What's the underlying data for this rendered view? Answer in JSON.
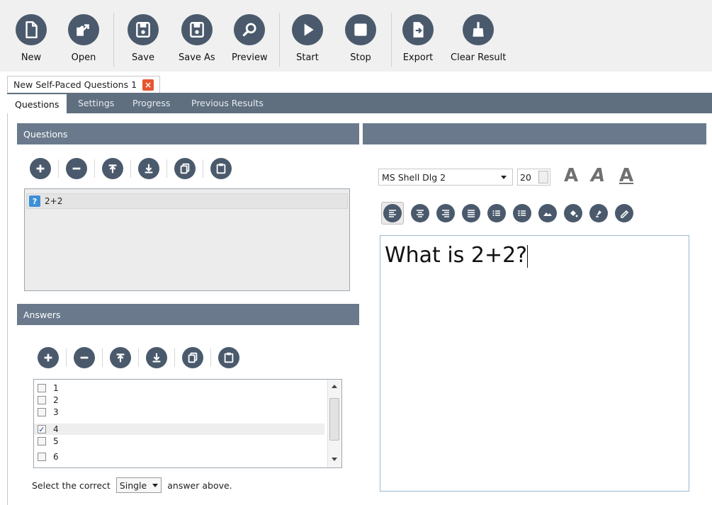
{
  "toolbar": {
    "buttons": [
      {
        "label": "New",
        "icon": "new-document-icon"
      },
      {
        "label": "Open",
        "icon": "open-folder-icon"
      },
      {
        "label": "Save",
        "icon": "save-disk-icon"
      },
      {
        "label": "Save As",
        "icon": "save-as-icon"
      },
      {
        "label": "Preview",
        "icon": "magnifier-icon"
      },
      {
        "label": "Start",
        "icon": "play-icon"
      },
      {
        "label": "Stop",
        "icon": "stop-icon"
      },
      {
        "label": "Export",
        "icon": "export-icon"
      },
      {
        "label": "Clear Result",
        "icon": "broom-icon"
      }
    ]
  },
  "document_tab": {
    "title": "New Self-Paced Questions 1",
    "close": "×"
  },
  "tabs": [
    "Questions",
    "Settings",
    "Progress",
    "Previous Results"
  ],
  "questions_panel": {
    "title": "Questions",
    "items": [
      {
        "badge": "?",
        "text": "2+2"
      }
    ]
  },
  "answers_panel": {
    "title": "Answers",
    "items": [
      {
        "label": "1",
        "checked": false
      },
      {
        "label": "2",
        "checked": false
      },
      {
        "label": "3",
        "checked": false
      },
      {
        "label": "4",
        "checked": true
      },
      {
        "label": "5",
        "checked": false
      },
      {
        "label": "6",
        "checked": false
      }
    ],
    "checkmark": "✓",
    "prompt_prefix": "Select the correct",
    "mode_value": "Single",
    "prompt_suffix": "answer above."
  },
  "editor": {
    "font_name": "MS Shell Dlg 2",
    "font_size": "20",
    "text": "What is 2+2?",
    "style_letter": "A"
  },
  "colors": {
    "icon_fill": "#4a5a6c",
    "header_bg": "#6a7a8c",
    "tabbar_bg": "#5f6f80",
    "close_bg": "#e8542f",
    "question_badge": "#3d8fd8"
  }
}
